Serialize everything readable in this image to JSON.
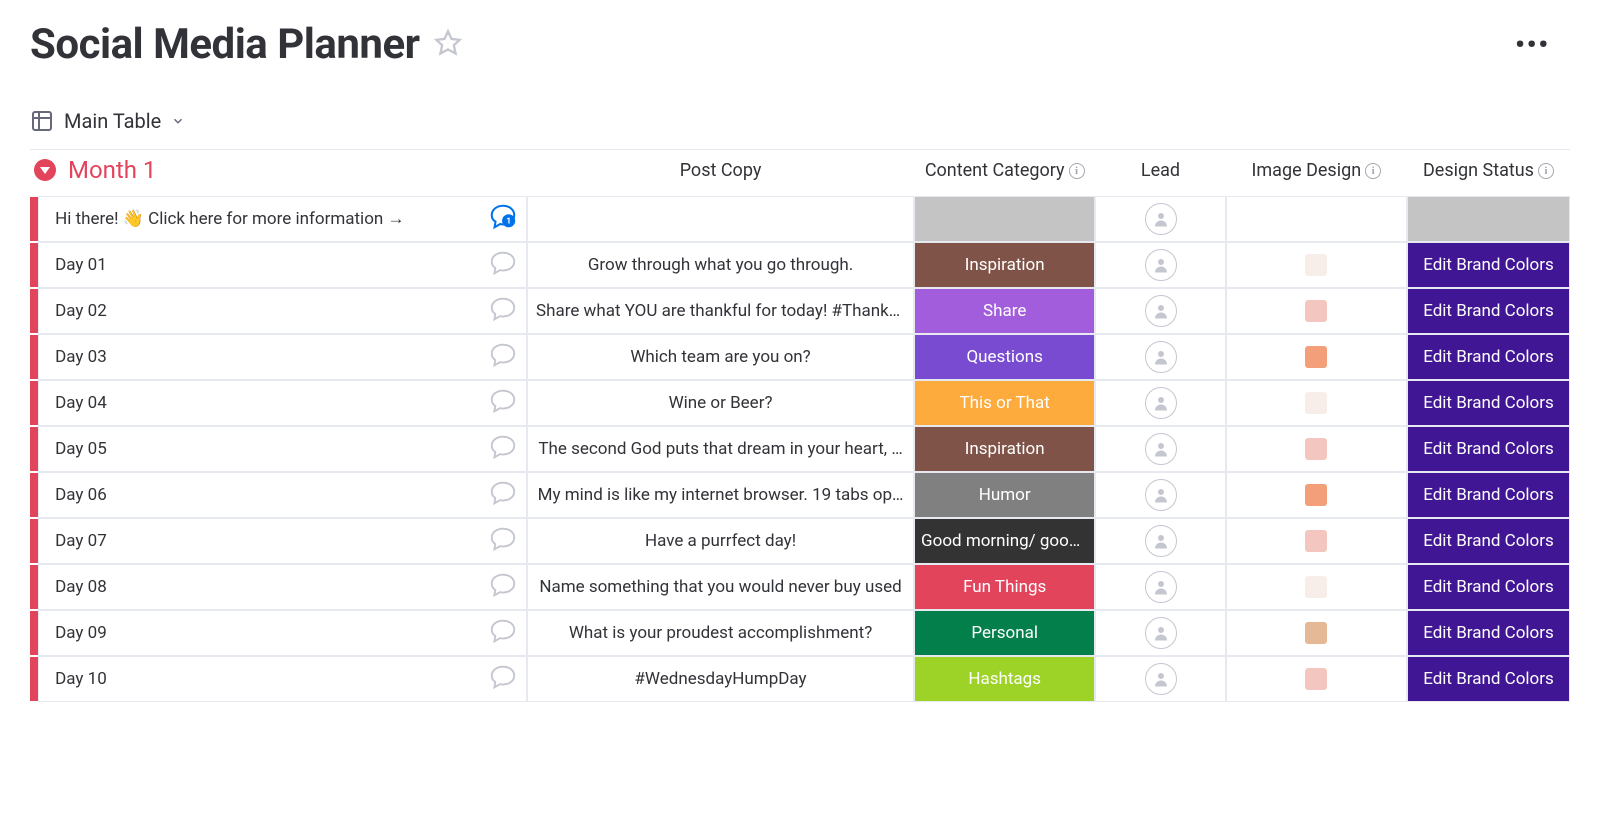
{
  "header": {
    "title": "Social Media Planner"
  },
  "view": {
    "name": "Main Table"
  },
  "group": {
    "title": "Month 1"
  },
  "columns": {
    "post_copy": "Post Copy",
    "content_category": "Content Category",
    "lead": "Lead",
    "image_design": "Image Design",
    "design_status": "Design Status"
  },
  "categoryColors": {
    "Inspiration": "#7f5347",
    "Share": "#a25ddc",
    "Questions": "#784bd1",
    "This or That": "#fdab3d",
    "Humor": "#808080",
    "Good morning/ good ...": "#333333",
    "Fun Things": "#e2445c",
    "Personal": "#037f4c",
    "Hashtags": "#9cd326"
  },
  "thumbColors": {
    "light": "#f7eee9",
    "pink": "#f3c7c0",
    "orange": "#f3a07a",
    "tan": "#e5b896"
  },
  "statusColor": "#401694",
  "rows": [
    {
      "name": "Hi there! 👋 Click here for more information →",
      "hasCommentBadge": true,
      "postCopy": "",
      "category": "",
      "catBg": "#c4c4c4",
      "thumb": "",
      "designStatus": "",
      "statusBg": "#c4c4c4"
    },
    {
      "name": "Day 01",
      "postCopy": "Grow through what you go through.",
      "category": "Inspiration",
      "catBg": "#7f5347",
      "thumb": "light",
      "designStatus": "Edit Brand Colors",
      "statusBg": "#401694"
    },
    {
      "name": "Day 02",
      "postCopy": "Share what YOU are thankful for today! #Thankf…",
      "category": "Share",
      "catBg": "#a25ddc",
      "thumb": "pink",
      "designStatus": "Edit Brand Colors",
      "statusBg": "#401694"
    },
    {
      "name": "Day 03",
      "postCopy": "Which team are you on?",
      "category": "Questions",
      "catBg": "#784bd1",
      "thumb": "orange",
      "designStatus": "Edit Brand Colors",
      "statusBg": "#401694"
    },
    {
      "name": "Day 04",
      "postCopy": "Wine or Beer?",
      "category": "This or That",
      "catBg": "#fdab3d",
      "thumb": "light",
      "designStatus": "Edit Brand Colors",
      "statusBg": "#401694"
    },
    {
      "name": "Day 05",
      "postCopy": "The second God puts that dream in your heart, …",
      "category": "Inspiration",
      "catBg": "#7f5347",
      "thumb": "pink",
      "designStatus": "Edit Brand Colors",
      "statusBg": "#401694"
    },
    {
      "name": "Day 06",
      "postCopy": "My mind is like my internet browser. 19 tabs op…",
      "category": "Humor",
      "catBg": "#808080",
      "thumb": "orange",
      "designStatus": "Edit Brand Colors",
      "statusBg": "#401694"
    },
    {
      "name": "Day 07",
      "postCopy": "Have a purrfect day!",
      "category": "Good morning/ good …",
      "catBg": "#333333",
      "thumb": "pink",
      "designStatus": "Edit Brand Colors",
      "statusBg": "#401694"
    },
    {
      "name": "Day 08",
      "postCopy": "Name something that you would never buy used",
      "category": "Fun Things",
      "catBg": "#e2445c",
      "thumb": "light",
      "designStatus": "Edit Brand Colors",
      "statusBg": "#401694"
    },
    {
      "name": "Day 09",
      "postCopy": "What is your proudest accomplishment?",
      "category": "Personal",
      "catBg": "#037f4c",
      "thumb": "tan",
      "designStatus": "Edit Brand Colors",
      "statusBg": "#401694"
    },
    {
      "name": "Day 10",
      "postCopy": "#WednesdayHumpDay",
      "category": "Hashtags",
      "catBg": "#9cd326",
      "thumb": "pink",
      "designStatus": "Edit Brand Colors",
      "statusBg": "#401694"
    }
  ]
}
